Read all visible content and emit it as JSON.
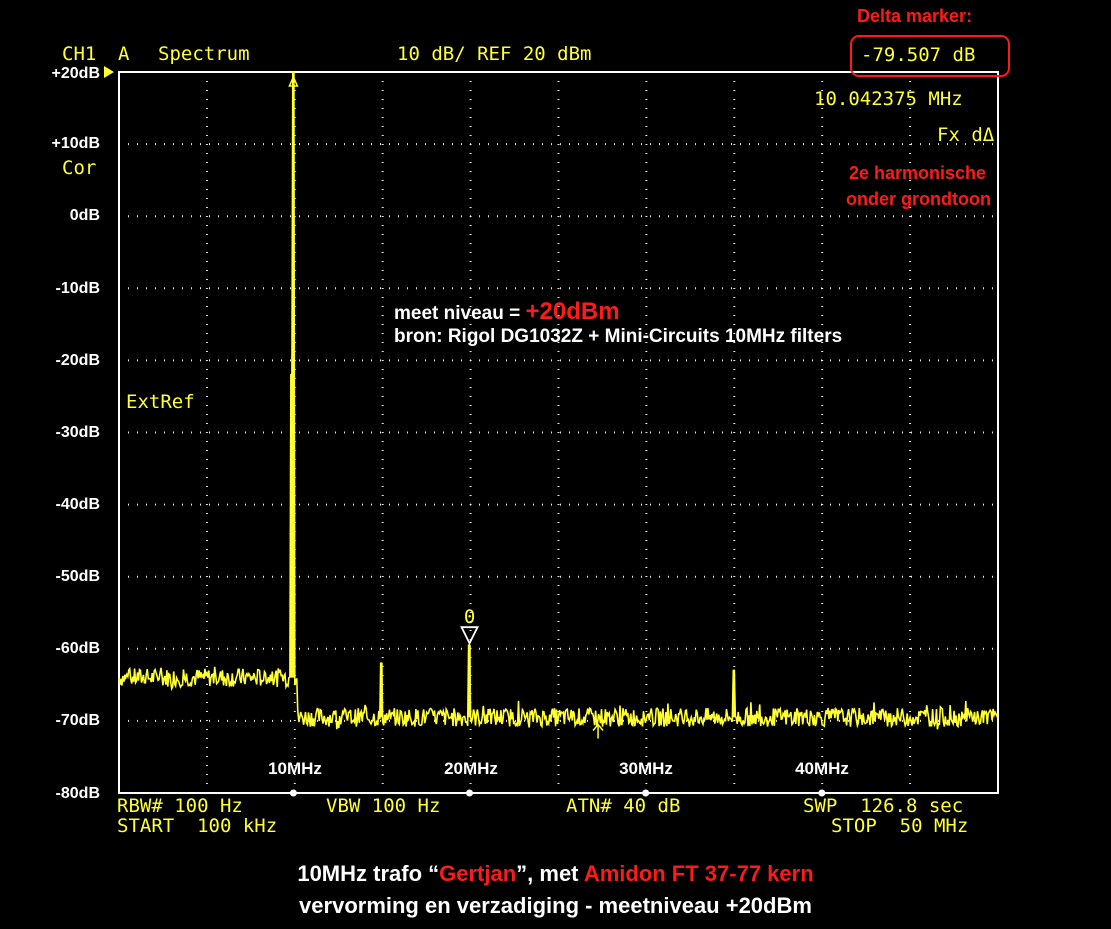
{
  "header": {
    "channel": "CH1",
    "trace": "A",
    "mode": "Spectrum",
    "scale": "10 dB/ REF 20 dBm",
    "delta_value": "-79.507 dB",
    "frequency": "10.042375 MHz",
    "marker_mode": "Fx dΔ"
  },
  "side_labels": {
    "cor": "Cor",
    "extref": "ExtRef"
  },
  "annotations": {
    "delta_title": "Delta marker:",
    "harmonic_line1": "2e harmonische",
    "harmonic_line2": "onder grondtoon",
    "level_prefix": "meet niveau = ",
    "level_value": "+20dBm",
    "source": "bron: Rigol DG1032Z + Mini-Circuits 10MHz filters",
    "marker_label": "0"
  },
  "footer": {
    "rbw": "RBW# 100 Hz",
    "vbw": "VBW 100 Hz",
    "atn": "ATN# 40 dB",
    "swp": "SWP  126.8 sec",
    "start": "START  100 kHz",
    "stop": "STOP  50 MHz"
  },
  "caption": {
    "line1_a": "10MHz trafo “",
    "line1_name": "Gertjan",
    "line1_b": "”, met ",
    "line1_core": "Amidon FT 37-77 kern",
    "line2": "vervorming en verzadiging - meetniveau +20dBm"
  },
  "colors": {
    "trace": "#ffff33",
    "grid": "#ffffff",
    "accent": "#ff1a1a"
  },
  "chart_data": {
    "type": "line",
    "x_unit": "MHz",
    "y_unit": "dB",
    "xlim": [
      0.1,
      50
    ],
    "ylim": [
      -80,
      20
    ],
    "y_ticks": [
      "+20dB",
      "+10dB",
      "0dB",
      "-10dB",
      "-20dB",
      "-30dB",
      "-40dB",
      "-50dB",
      "-60dB",
      "-70dB",
      "-80dB"
    ],
    "y_tick_values": [
      20,
      10,
      0,
      -10,
      -20,
      -30,
      -40,
      -50,
      -60,
      -70,
      -80
    ],
    "x_ticks": [
      "10MHz",
      "20MHz",
      "30MHz",
      "40MHz"
    ],
    "x_tick_values": [
      10,
      20,
      30,
      40
    ],
    "grid": true,
    "series": [
      {
        "noise_floor": [
          {
            "x_from": 0.1,
            "x_to": 9.9,
            "y": -64
          },
          {
            "x_from": 10.2,
            "x_to": 50,
            "y": -69.5
          }
        ],
        "peaks": [
          {
            "x": 10.0,
            "y": 20
          },
          {
            "x": 9.9,
            "y": -22
          },
          {
            "x": 15.0,
            "y": -62
          },
          {
            "x": 20.0,
            "y": -59.5
          },
          {
            "x": 35.0,
            "y": -63
          }
        ]
      }
    ],
    "markers": [
      {
        "label": "0",
        "x": 20.0,
        "y": -59.5,
        "kind": "delta"
      }
    ]
  }
}
